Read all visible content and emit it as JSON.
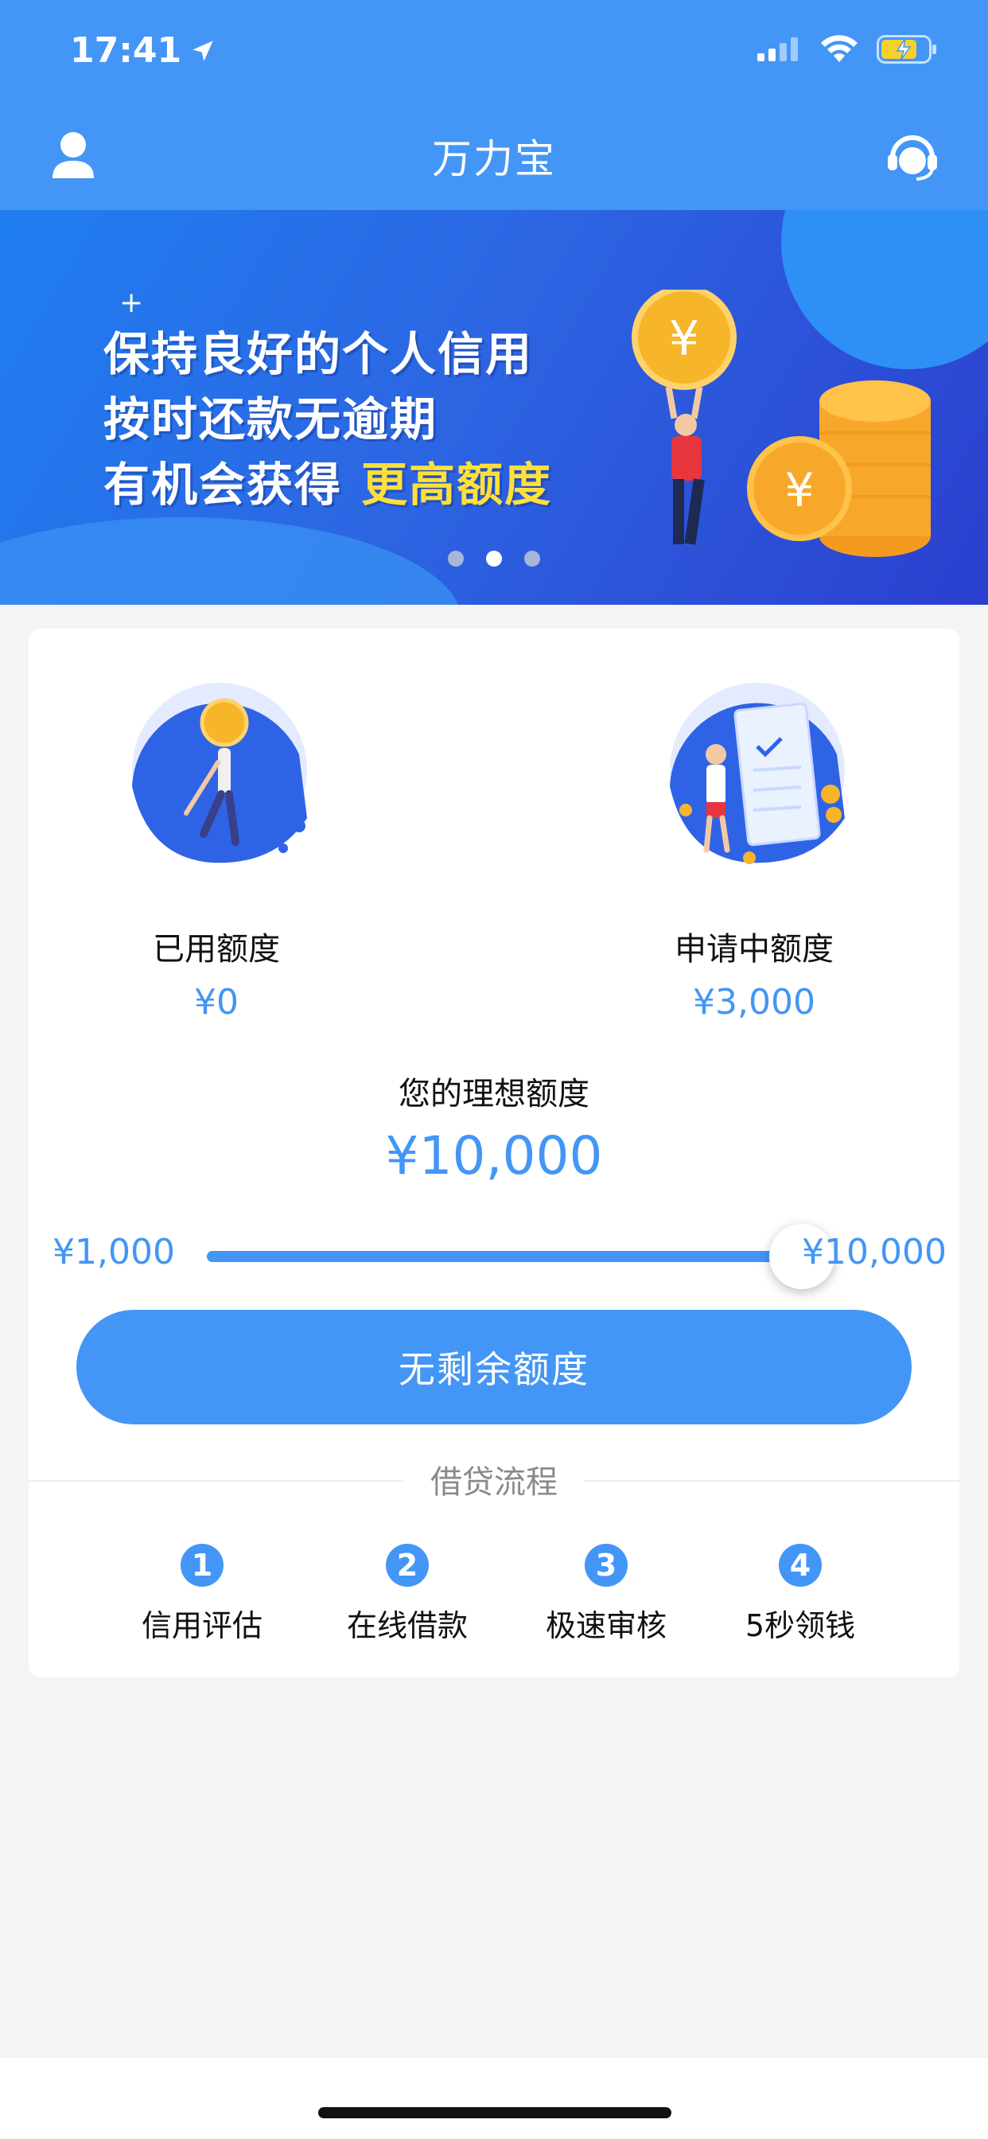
{
  "status": {
    "time": "17:41"
  },
  "nav": {
    "title": "万力宝"
  },
  "banner": {
    "line1": "保持良好的个人信用",
    "line2": "按时还款无逾期",
    "line3": "有机会获得",
    "highlight": "更高额度",
    "dots": 3,
    "active_dot": 1
  },
  "stats": {
    "used": {
      "label": "已用额度",
      "value": "¥0"
    },
    "applying": {
      "label": "申请中额度",
      "value": "¥3,000"
    }
  },
  "ideal": {
    "label": "您的理想额度",
    "value": "¥10,000"
  },
  "slider": {
    "min_label": "¥1,000",
    "max_label": "¥10,000",
    "fraction": 1.0
  },
  "cta": {
    "label": "无剩余额度"
  },
  "process": {
    "title": "借贷流程",
    "steps": [
      {
        "num": "1",
        "label": "信用评估"
      },
      {
        "num": "2",
        "label": "在线借款"
      },
      {
        "num": "3",
        "label": "极速审核"
      },
      {
        "num": "4",
        "label": "5秒领钱"
      }
    ]
  },
  "colors": {
    "primary": "#4396f5",
    "highlight": "#ffe03a",
    "background": "#f4f4f4"
  }
}
